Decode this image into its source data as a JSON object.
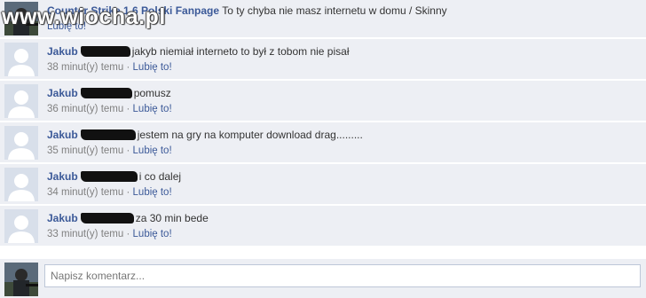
{
  "watermark": "www.wiocha.pl",
  "comments": [
    {
      "author": "Counter Strike 1.6 Polski Fanpage",
      "message": "To ty chyba nie masz internetu w domu / Skinny",
      "time": "",
      "like": "Lubię to!"
    },
    {
      "author": "Jakub",
      "message": "jakyb niemiał interneto to był z tobom nie pisał",
      "time": "38 minut(y) temu",
      "like": "Lubię to!"
    },
    {
      "author": "Jakub",
      "message": "pomusz",
      "time": "36 minut(y) temu",
      "like": "Lubię to!"
    },
    {
      "author": "Jakub",
      "message": "jestem na gry na komputer download drag.........",
      "time": "35 minut(y) temu",
      "like": "Lubię to!"
    },
    {
      "author": "Jakub",
      "message": "i co dalej",
      "time": "34 minut(y) temu",
      "like": "Lubię to!"
    },
    {
      "author": "Jakub",
      "message": "za 30 min bede",
      "time": "33 minut(y) temu",
      "like": "Lubię to!"
    }
  ],
  "separator": "·",
  "composer": {
    "placeholder": "Napisz komentarz..."
  },
  "icons": {
    "default_avatar": "default-avatar-icon",
    "page_avatar": "soldier-avatar-icon"
  },
  "colors": {
    "link": "#3b5998",
    "background": "#edeff4",
    "muted": "#808080"
  }
}
